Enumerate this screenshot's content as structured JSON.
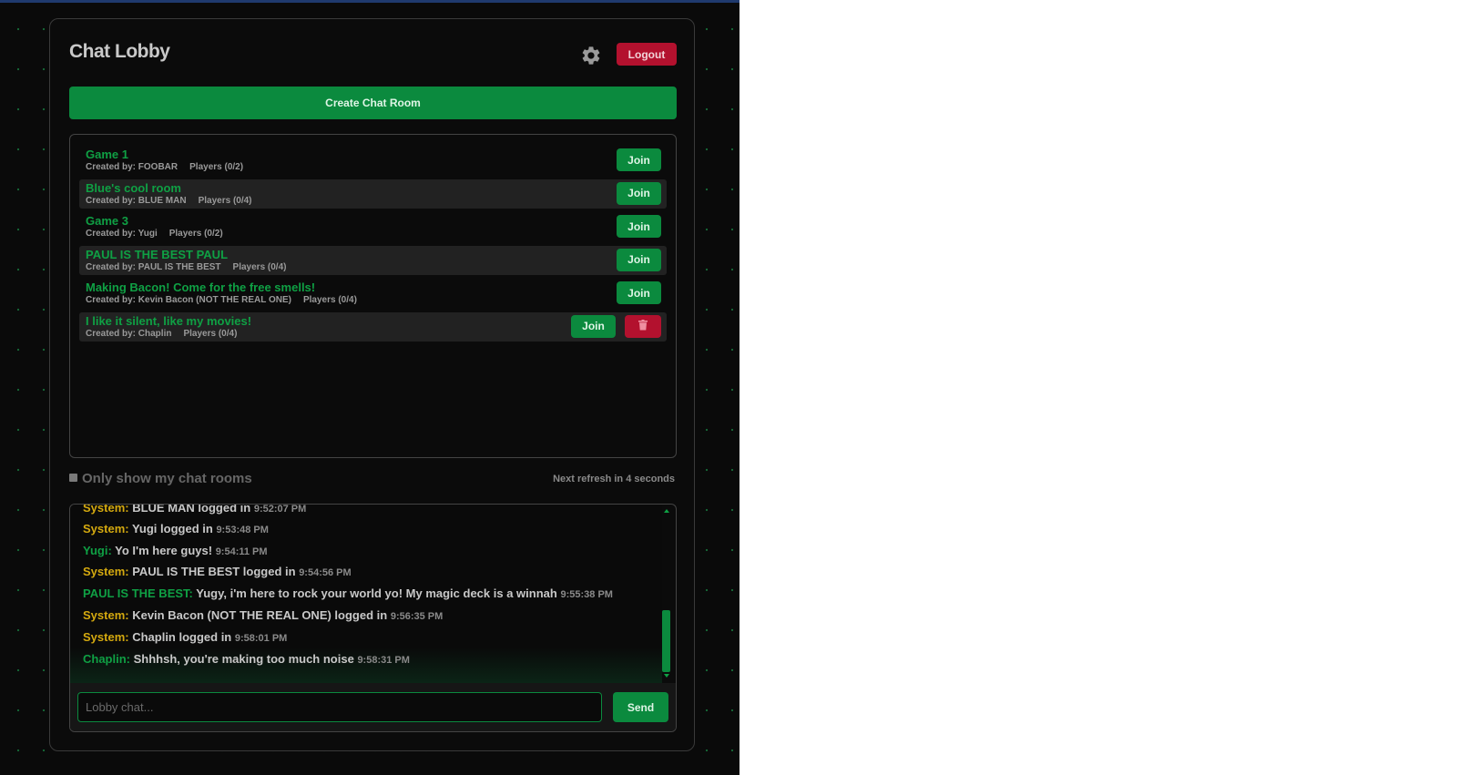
{
  "header": {
    "title": "Chat Lobby",
    "settings_icon": "gear-icon",
    "logout_label": "Logout"
  },
  "create_room_label": "Create Chat Room",
  "rooms": [
    {
      "name": "Game 1",
      "created_by": "Created by: FOOBAR",
      "players": "Players (0/2)",
      "join_label": "Join",
      "deletable": false
    },
    {
      "name": "Blue's cool room",
      "created_by": "Created by: BLUE MAN",
      "players": "Players (0/4)",
      "join_label": "Join",
      "deletable": false
    },
    {
      "name": "Game 3",
      "created_by": "Created by: Yugi",
      "players": "Players (0/2)",
      "join_label": "Join",
      "deletable": false
    },
    {
      "name": "PAUL IS THE BEST PAUL",
      "created_by": "Created by: PAUL IS THE BEST",
      "players": "Players (0/4)",
      "join_label": "Join",
      "deletable": false
    },
    {
      "name": "Making Bacon! Come for the free smells!",
      "created_by": "Created by: Kevin Bacon (NOT THE REAL ONE)",
      "players": "Players (0/4)",
      "join_label": "Join",
      "deletable": false
    },
    {
      "name": "I like it silent, like my movies!",
      "created_by": "Created by: Chaplin",
      "players": "Players (0/4)",
      "join_label": "Join",
      "deletable": true
    }
  ],
  "filter": {
    "label": "Only show my chat rooms",
    "checked": false
  },
  "refresh_text": "Next refresh in 4 seconds",
  "messages": [
    {
      "sender": "System:",
      "kind": "system",
      "text": "BLUE MAN logged in",
      "time": "9:52:07 PM"
    },
    {
      "sender": "System:",
      "kind": "system",
      "text": "Yugi logged in",
      "time": "9:53:48 PM"
    },
    {
      "sender": "Yugi:",
      "kind": "user",
      "text": "Yo I'm here guys!",
      "time": "9:54:11 PM"
    },
    {
      "sender": "System:",
      "kind": "system",
      "text": "PAUL IS THE BEST logged in",
      "time": "9:54:56 PM"
    },
    {
      "sender": "PAUL IS THE BEST:",
      "kind": "user",
      "text": "Yugy, i'm here to rock your world yo! My magic deck is a winnah",
      "time": "9:55:38 PM"
    },
    {
      "sender": "System:",
      "kind": "system",
      "text": "Kevin Bacon (NOT THE REAL ONE) logged in",
      "time": "9:56:35 PM"
    },
    {
      "sender": "System:",
      "kind": "system",
      "text": "Chaplin logged in",
      "time": "9:58:01 PM"
    },
    {
      "sender": "Chaplin:",
      "kind": "user",
      "text": "Shhhsh, you're making too much noise",
      "time": "9:58:31 PM"
    }
  ],
  "chat_input": {
    "placeholder": "Lobby chat...",
    "value": ""
  },
  "send_label": "Send",
  "colors": {
    "accent_green": "#0b8a3e",
    "room_name_green": "#0fa044",
    "danger_red": "#b3112e",
    "system_yellow": "#d4a90f"
  }
}
